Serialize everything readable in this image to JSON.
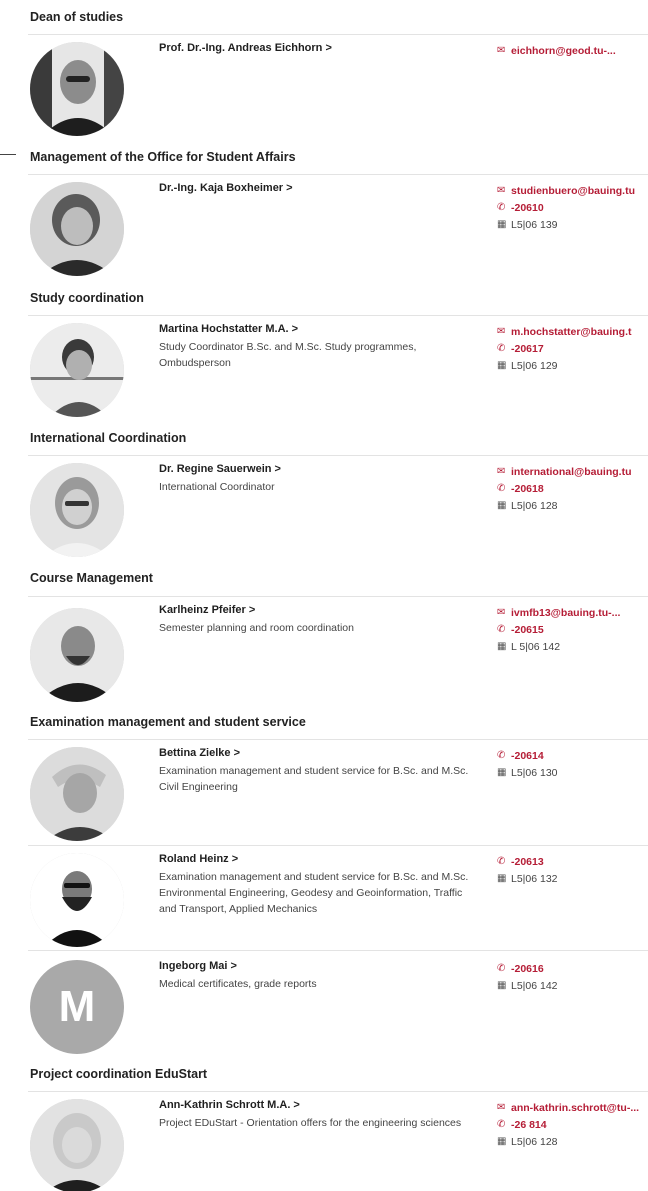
{
  "sections": [
    {
      "heading": "Dean of studies",
      "people": [
        {
          "name": "Prof. Dr.-Ing. Andreas Eichhorn >",
          "role": "",
          "email": "eichhorn@geod.tu-...",
          "phone": "",
          "room": ""
        }
      ]
    },
    {
      "heading": "Management of the Office for Student Affairs",
      "people": [
        {
          "name": "Dr.-Ing. Kaja Boxheimer >",
          "role": "",
          "email": "studienbuero@bauing.tu",
          "phone": "-20610",
          "room": "L5|06 139"
        }
      ]
    },
    {
      "heading": "Study coordination",
      "people": [
        {
          "name": "Martina Hochstatter M.A. >",
          "role": "Study Coordinator B.Sc. and M.Sc. Study programmes, Ombudsperson",
          "email": "m.hochstatter@bauing.t",
          "phone": "-20617",
          "room": "L5|06 129"
        }
      ]
    },
    {
      "heading": "International Coordination",
      "people": [
        {
          "name": "Dr. Regine Sauerwein >",
          "role": "International Coordinator",
          "email": "international@bauing.tu",
          "phone": "-20618",
          "room": "L5|06 128"
        }
      ]
    },
    {
      "heading": "Course Management",
      "people": [
        {
          "name": "Karlheinz Pfeifer >",
          "role": "Semester planning and room coordination",
          "email": "ivmfb13@bauing.tu-...",
          "phone": "-20615",
          "room": "L 5|06 142"
        }
      ]
    },
    {
      "heading": "Examination management and student service",
      "people": [
        {
          "name": "Bettina Zielke >",
          "role": "Examination management and student service for B.Sc. and M.Sc. Civil Engineering",
          "email": "",
          "phone": "-20614",
          "room": "L5|06 130"
        },
        {
          "name": "Roland Heinz >",
          "role": "Examination management and student service for B.Sc. and M.Sc. Environmental Engineering, Geodesy and Geoinformation, Traffic and Transport, Applied Mechanics",
          "email": "",
          "phone": "-20613",
          "room": "L5|06 132"
        },
        {
          "name": "Ingeborg Mai >",
          "role": "Medical certificates, grade reports",
          "email": "",
          "phone": "-20616",
          "room": "L5|06 142",
          "avatar_letter": "M"
        }
      ]
    },
    {
      "heading": "Project coordination EduStart",
      "people": [
        {
          "name": "Ann-Kathrin Schrott M.A. >",
          "role": "Project EDuStart - Orientation offers for the engineering sciences",
          "email": "ann-kathrin.schrott@tu-...",
          "phone": "-26 814",
          "room": "L5|06 128"
        }
      ]
    }
  ],
  "colors": {
    "accent": "#b51d36",
    "text": "#1f1f1f",
    "divider": "#e3e3e3",
    "avatar_placeholder": "#a9a9a9"
  },
  "icons": {
    "email": "mail-icon",
    "phone": "phone-icon",
    "room": "building-icon"
  }
}
